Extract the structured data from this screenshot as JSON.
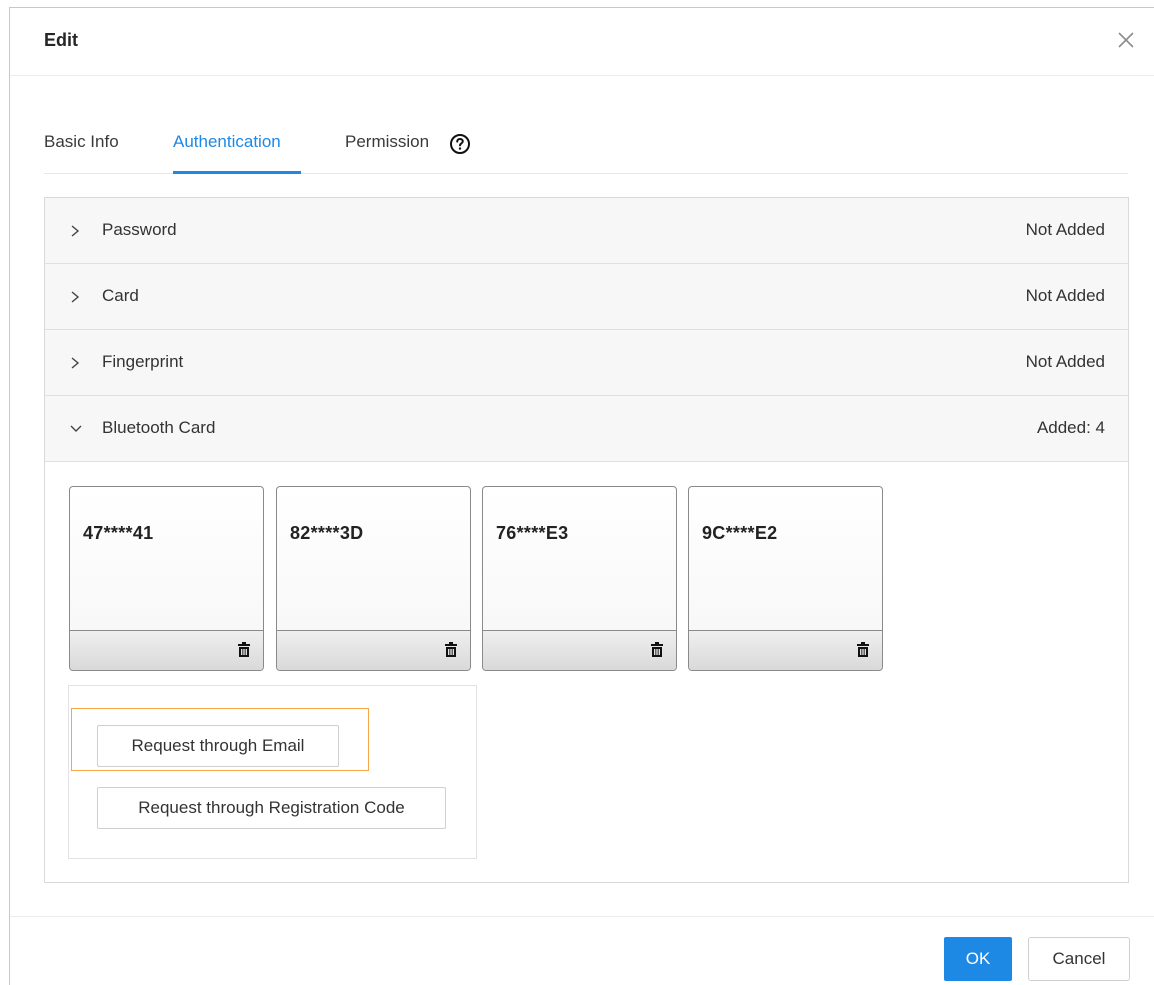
{
  "dialog": {
    "title": "Edit",
    "close_icon": "close-icon"
  },
  "tabs": [
    {
      "label": "Basic Info",
      "active": false
    },
    {
      "label": "Authentication",
      "active": true
    },
    {
      "label": "Permission",
      "active": false,
      "icon": "help-circle-icon"
    }
  ],
  "sections": [
    {
      "label": "Password",
      "status": "Not Added",
      "expanded": false
    },
    {
      "label": "Card",
      "status": "Not Added",
      "expanded": false
    },
    {
      "label": "Fingerprint",
      "status": "Not Added",
      "expanded": false
    },
    {
      "label": "Bluetooth Card",
      "status": "Added: 4",
      "expanded": true
    }
  ],
  "bluetooth_cards": [
    {
      "id": "47****41"
    },
    {
      "id": "82****3D"
    },
    {
      "id": "76****E3"
    },
    {
      "id": "9C****E2"
    }
  ],
  "request": {
    "email_label": "Request through Email",
    "code_label": "Request through Registration Code"
  },
  "footer": {
    "ok_label": "OK",
    "cancel_label": "Cancel"
  },
  "colors": {
    "accent": "#1e88e5",
    "highlight": "#f4a84a"
  }
}
